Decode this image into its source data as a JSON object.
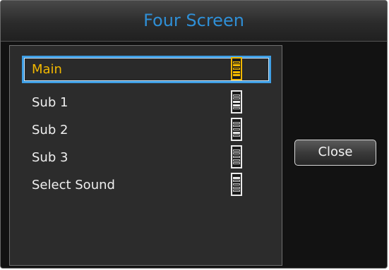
{
  "dialog": {
    "title": "Four Screen",
    "close_label": "Close"
  },
  "menu": {
    "items": [
      {
        "label": "Main",
        "selected": true,
        "level_segments_on": [
          1,
          3,
          4
        ]
      },
      {
        "label": "Sub 1",
        "selected": false,
        "level_segments_on": [
          2,
          3
        ]
      },
      {
        "label": "Sub 2",
        "selected": false,
        "level_segments_on": [
          3
        ]
      },
      {
        "label": "Sub 3",
        "selected": false,
        "level_segments_on": []
      },
      {
        "label": "Select Sound",
        "selected": false,
        "level_segments_on": [
          0
        ]
      }
    ]
  },
  "colors": {
    "title_text": "#2f8fd6",
    "selection_border": "#3f9fe5",
    "selected_text": "#f2b800",
    "panel_background": "#2c2c2c",
    "window_background": "#121212"
  },
  "icons": {
    "level_indicator": "segmented-level-icon"
  }
}
